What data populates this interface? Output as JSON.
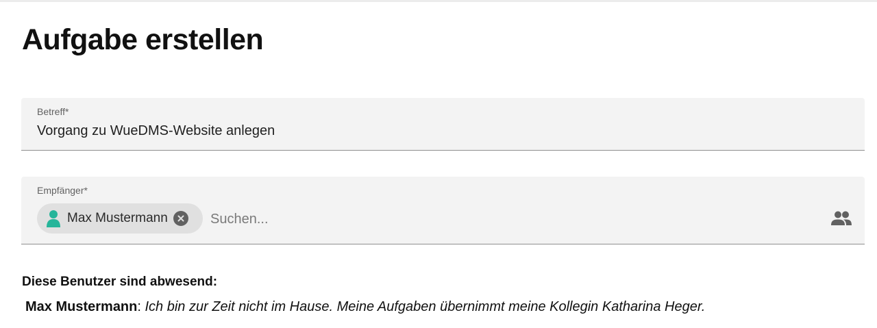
{
  "page": {
    "title": "Aufgabe erstellen"
  },
  "subject_field": {
    "label": "Betreff*",
    "value": "Vorgang zu WueDMS-Website anlegen"
  },
  "recipient_field": {
    "label": "Empfänger*",
    "chips": [
      {
        "name": "Max Mustermann",
        "icon": "person-icon",
        "remove_icon": "close-circle-icon"
      }
    ],
    "search_placeholder": "Suchen...",
    "search_value": "",
    "picker_icon": "people-icon"
  },
  "absence": {
    "heading": "Diese Benutzer sind abwesend:",
    "entries": [
      {
        "name": "Max Mustermann",
        "separator": ": ",
        "message": "Ich bin zur Zeit nicht im Hause. Meine Aufgaben übernimmt meine Kollegin Katharina Heger."
      }
    ]
  },
  "colors": {
    "accent_teal": "#26b59a",
    "field_background": "#f3f3f3",
    "chip_background": "#e0e0e0"
  }
}
